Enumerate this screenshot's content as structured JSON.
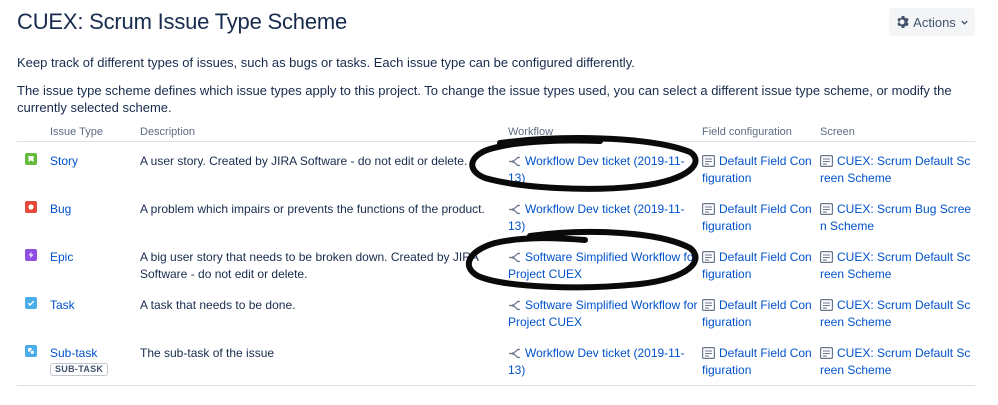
{
  "page": {
    "title": "CUEX: Scrum Issue Type Scheme",
    "actions_label": "Actions",
    "intro1": "Keep track of different types of issues, such as bugs or tasks. Each issue type can be configured differently.",
    "intro2": "The issue type scheme defines which issue types apply to this project. To change the issue types used, you can select a different issue type scheme, or modify the currently selected scheme."
  },
  "table": {
    "headers": {
      "issue_type": "Issue Type",
      "description": "Description",
      "workflow": "Workflow",
      "field_configuration": "Field configuration",
      "screen": "Screen"
    },
    "rows": [
      {
        "type": "Story",
        "icon": "story-icon",
        "icon_color": "#63ba3c",
        "description": "A user story. Created by JIRA Software - do not edit or delete.",
        "workflow": "Workflow Dev ticket (2019-11-13)",
        "field_configuration": "Default Field Configuration",
        "screen": "CUEX: Scrum Default Screen Scheme"
      },
      {
        "type": "Bug",
        "icon": "bug-icon",
        "icon_color": "#e5493a",
        "description": "A problem which impairs or prevents the functions of the product.",
        "workflow": "Workflow Dev ticket (2019-11-13)",
        "field_configuration": "Default Field Configuration",
        "screen": "CUEX: Scrum Bug Screen Scheme"
      },
      {
        "type": "Epic",
        "icon": "epic-icon",
        "icon_color": "#904ee2",
        "description": "A big user story that needs to be broken down. Created by JIRA Software - do not edit or delete.",
        "workflow": "Software Simplified Workflow for Project CUEX",
        "field_configuration": "Default Field Configuration",
        "screen": "CUEX: Scrum Default Screen Scheme"
      },
      {
        "type": "Task",
        "icon": "task-icon",
        "icon_color": "#4bade8",
        "description": "A task that needs to be done.",
        "workflow": "Software Simplified Workflow for Project CUEX",
        "field_configuration": "Default Field Configuration",
        "screen": "CUEX: Scrum Default Screen Scheme"
      },
      {
        "type": "Sub-task",
        "icon": "subtask-icon",
        "icon_color": "#4bade8",
        "badge": "SUB-TASK",
        "description": "The sub-task of the issue",
        "workflow": "Workflow Dev ticket (2019-11-13)",
        "field_configuration": "Default Field Configuration",
        "screen": "CUEX: Scrum Default Screen Scheme"
      }
    ]
  }
}
